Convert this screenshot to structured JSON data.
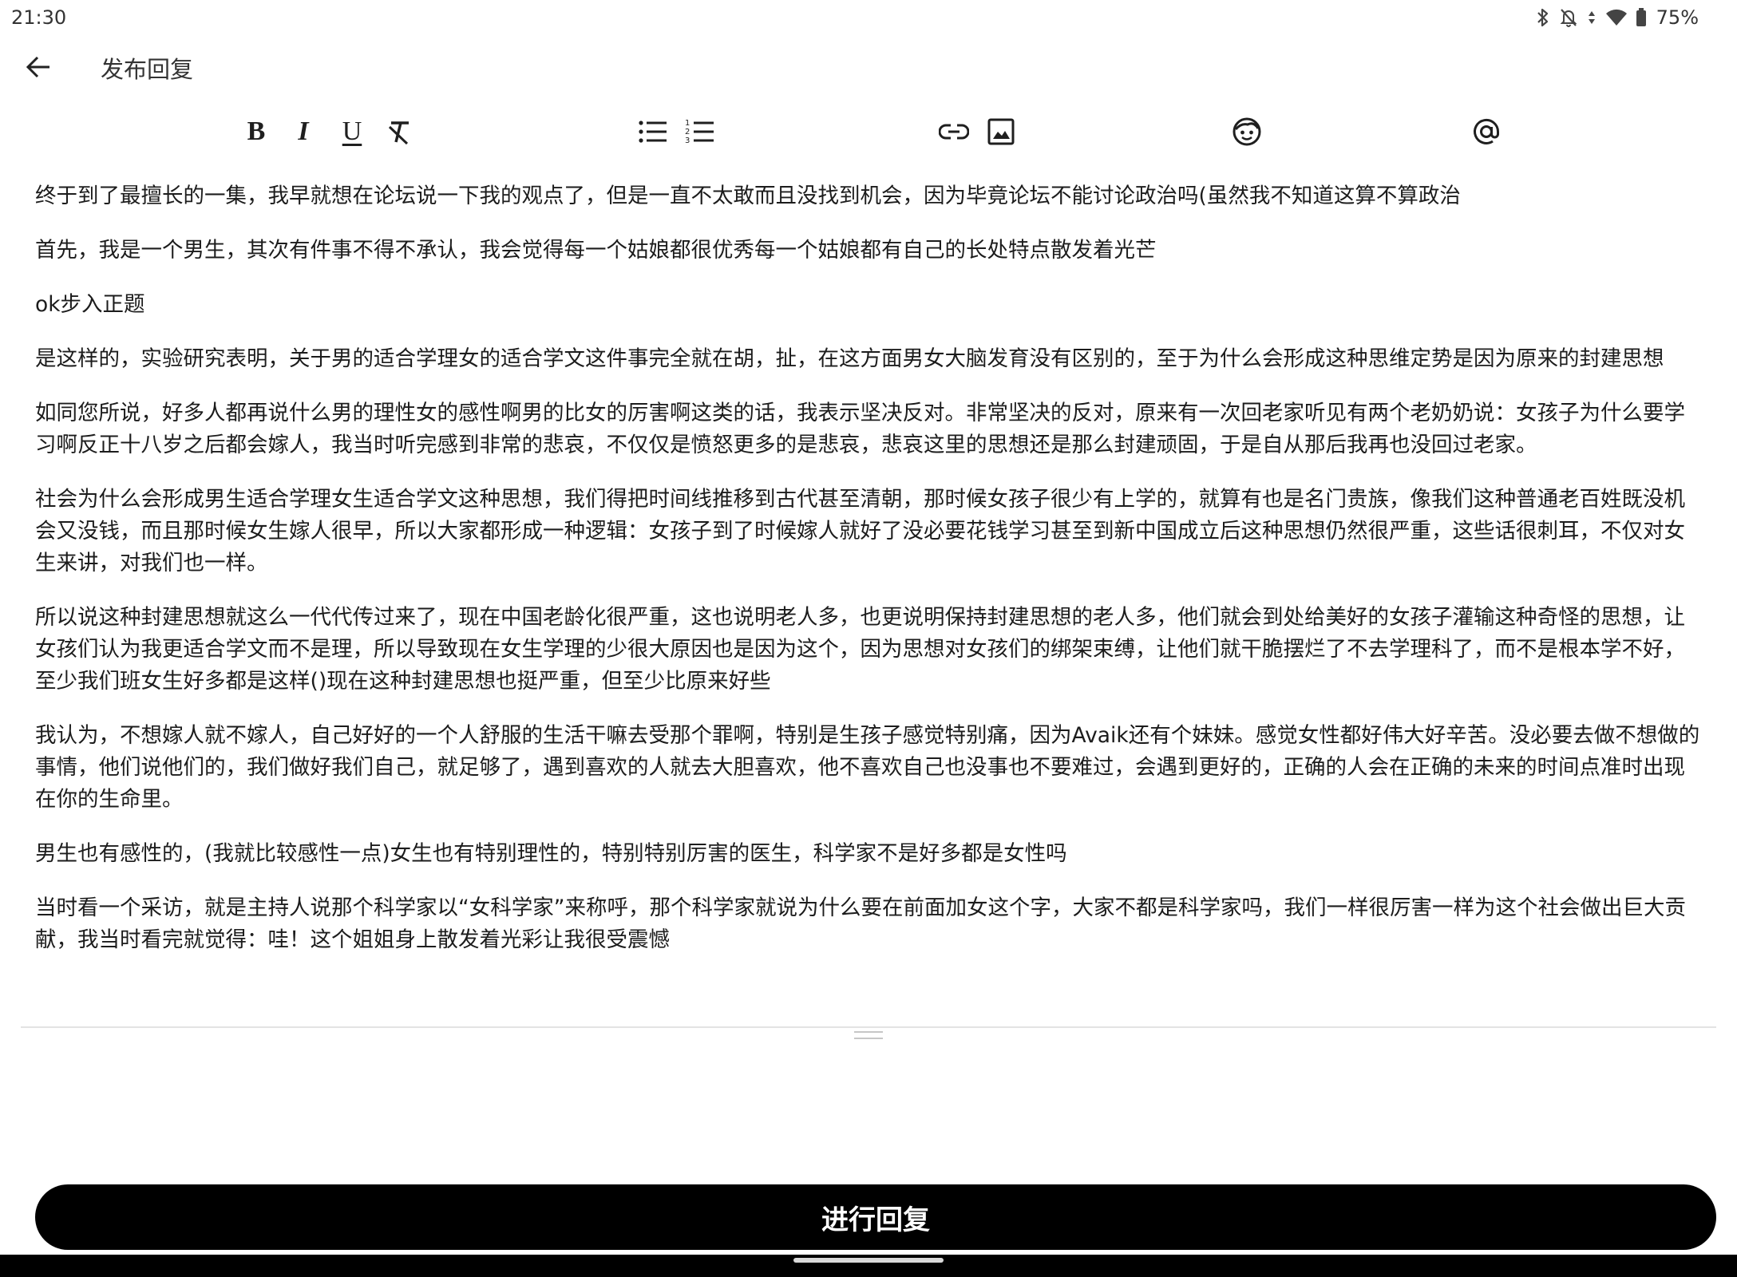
{
  "status_bar": {
    "time": "21:30",
    "battery": "75%",
    "icons": [
      "bluetooth-icon",
      "mute-icon",
      "data-icon",
      "wifi-icon",
      "battery-icon"
    ]
  },
  "header": {
    "title": "发布回复",
    "back_icon": "arrow-left-icon"
  },
  "toolbar": {
    "buttons": [
      {
        "name": "bold-button",
        "icon": "bold-icon",
        "label": "B"
      },
      {
        "name": "italic-button",
        "icon": "italic-icon",
        "label": "I"
      },
      {
        "name": "underline-button",
        "icon": "underline-icon",
        "label": "U"
      },
      {
        "name": "clear-format-button",
        "icon": "clear-format-icon"
      },
      {
        "name": "bullet-list-button",
        "icon": "bullet-list-icon"
      },
      {
        "name": "numbered-list-button",
        "icon": "numbered-list-icon"
      },
      {
        "name": "link-button",
        "icon": "link-icon"
      },
      {
        "name": "image-button",
        "icon": "image-icon"
      },
      {
        "name": "emoji-button",
        "icon": "emoji-icon"
      },
      {
        "name": "mention-button",
        "icon": "at-icon"
      }
    ]
  },
  "editor": {
    "paragraphs": [
      " 终于到了最擅长的一集，我早就想在论坛说一下我的观点了，但是一直不太敢而且没找到机会，因为毕竟论坛不能讨论政治吗(虽然我不知道这算不算政治",
      "首先，我是一个男生，其次有件事不得不承认，我会觉得每一个姑娘都很优秀每一个姑娘都有自己的长处特点散发着光芒",
      "ok步入正题",
      "是这样的，实验研究表明，关于男的适合学理女的适合学文这件事完全就在胡，扯，在这方面男女大脑发育没有区别的，至于为什么会形成这种思维定势是因为原来的封建思想",
      "如同您所说，好多人都再说什么男的理性女的感性啊男的比女的厉害啊这类的话，我表示坚决反对。非常坚决的反对，原来有一次回老家听见有两个老奶奶说：女孩子为什么要学习啊反正十八岁之后都会嫁人，我当时听完感到非常的悲哀，不仅仅是愤怒更多的是悲哀，悲哀这里的思想还是那么封建顽固，于是自从那后我再也没回过老家。",
      "社会为什么会形成男生适合学理女生适合学文这种思想，我们得把时间线推移到古代甚至清朝，那时候女孩子很少有上学的，就算有也是名门贵族，像我们这种普通老百姓既没机会又没钱，而且那时候女生嫁人很早，所以大家都形成一种逻辑：女孩子到了时候嫁人就好了没必要花钱学习甚至到新中国成立后这种思想仍然很严重，这些话很刺耳，不仅对女生来讲，对我们也一样。",
      "所以说这种封建思想就这么一代代传过来了，现在中国老龄化很严重，这也说明老人多，也更说明保持封建思想的老人多，他们就会到处给美好的女孩子灌输这种奇怪的思想，让女孩们认为我更适合学文而不是理，所以导致现在女生学理的少很大原因也是因为这个，因为思想对女孩们的绑架束缚，让他们就干脆摆烂了不去学理科了，而不是根本学不好，至少我们班女生好多都是这样()现在这种封建思想也挺严重，但至少比原来好些",
      "我认为，不想嫁人就不嫁人，自己好好的一个人舒服的生活干嘛去受那个罪啊，特别是生孩子感觉特别痛，因为Avaik还有个妹妹。感觉女性都好伟大好辛苦。没必要去做不想做的事情，他们说他们的，我们做好我们自己，就足够了，遇到喜欢的人就去大胆喜欢，他不喜欢自己也没事也不要难过，会遇到更好的，正确的人会在正确的未来的时间点准时出现在你的生命里。",
      "男生也有感性的，(我就比较感性一点)女生也有特别理性的，特别特别厉害的医生，科学家不是好多都是女性吗",
      "当时看一个采访，就是主持人说那个科学家以“女科学家”来称呼，那个科学家就说为什么要在前面加女这个字，大家不都是科学家吗，我们一样很厉害一样为这个社会做出巨大贡献，我当时看完就觉得：哇！这个姐姐身上散发着光彩让我很受震憾"
    ]
  },
  "submit": {
    "label": "进行回复"
  }
}
